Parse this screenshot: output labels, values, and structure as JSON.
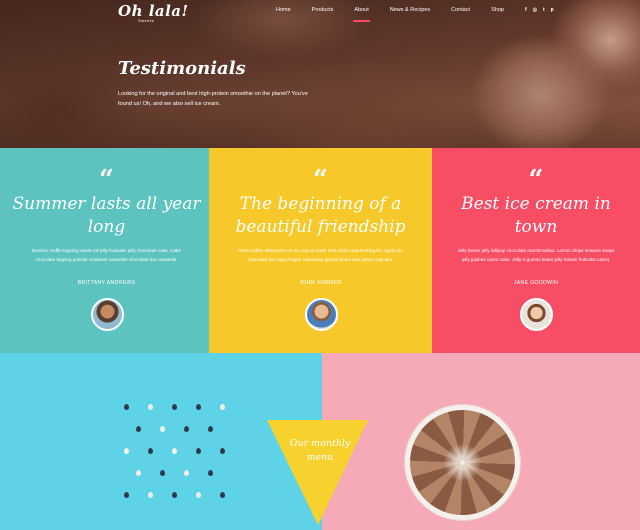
{
  "brand": {
    "name": "Oh lala!",
    "tagline": "Sweets"
  },
  "nav": {
    "items": [
      {
        "label": "Home"
      },
      {
        "label": "Products"
      },
      {
        "label": "About"
      },
      {
        "label": "News & Recipes"
      },
      {
        "label": "Contact"
      },
      {
        "label": "Shop"
      }
    ],
    "active": "About",
    "socials": [
      "f",
      "◎",
      "t",
      "p"
    ]
  },
  "hero": {
    "title": "Testimonials",
    "text": "Looking for the original and best high-protein smoothie on the planet? You've found us! Oh, and we also sell ice cream."
  },
  "testimonials": [
    {
      "quote_mark": "“",
      "title": "Summer lasts all year long",
      "body": "Bonbon muffin topping sweet roll jelly fruitcake jelly chocolate cake. Cake chocolate topping powder croissant caramels chocolate bar caramels.",
      "name": "BRITTANY ANDREWS",
      "color": "#5cc3be"
    },
    {
      "quote_mark": "“",
      "title": "The beginning of a beautiful friendship",
      "body": "Great coffee alternative on my way to work! Just what I was looking for. Apple pie chocolate bar icing dragée macaroon gummi bears and pastry cupcake.",
      "name": "JOHN SUMMER",
      "color": "#f7c82a"
    },
    {
      "quote_mark": "“",
      "title": "Best ice cream in town",
      "body": "Jelly beans jelly lollipop chocolate marshmallow. Lemon drops sesame snaps jelly jujubes carrot cake. Jelly-o gummi bears jelly halvah fruitcake carrot.",
      "name": "JANE GOODWIN",
      "color": "#f74d65"
    }
  ],
  "menu": {
    "label": "Our monthly menu"
  },
  "colors": {
    "left_panel": "#5ed3e8",
    "right_panel": "#f6a9b6",
    "triangle": "#f7d12e"
  }
}
